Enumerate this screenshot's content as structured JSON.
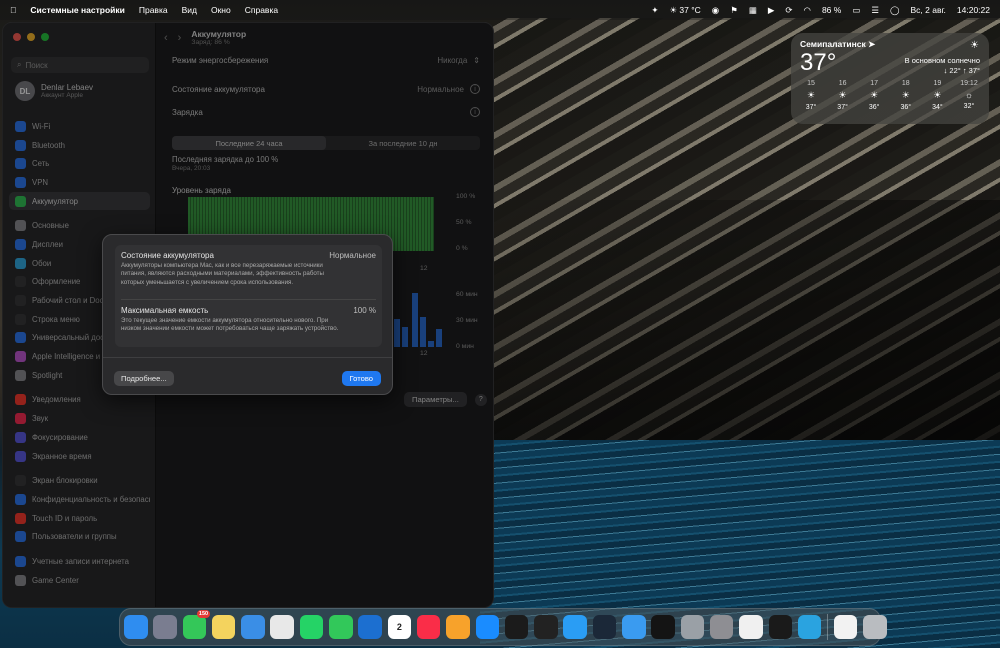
{
  "menubar": {
    "apple": "",
    "app_name": "Системные настройки",
    "menus": [
      "Правка",
      "Вид",
      "Окно",
      "Справка"
    ],
    "weather": "37 °C",
    "battery": "86 %",
    "date": "Вс, 2 авг.",
    "time": "14:20:22"
  },
  "sidebar": {
    "search_placeholder": "Поиск",
    "user_initials": "DL",
    "user_name": "Denlar Lebaev",
    "user_sub": "Аккаунт Apple",
    "items": [
      {
        "label": "Wi-Fi",
        "color": "#2f7bf6"
      },
      {
        "label": "Bluetooth",
        "color": "#2f7bf6"
      },
      {
        "label": "Сеть",
        "color": "#2f7bf6"
      },
      {
        "label": "VPN",
        "color": "#2f7bf6"
      },
      {
        "label": "Аккумулятор",
        "color": "#34c759"
      },
      {
        "label": "Основные",
        "color": "#8e8e93"
      },
      {
        "label": "Дисплеи",
        "color": "#2f7bf6"
      },
      {
        "label": "Обои",
        "color": "#32ade6"
      },
      {
        "label": "Оформление",
        "color": "#3a3a3c"
      },
      {
        "label": "Рабочий стол и Dock",
        "color": "#3a3a3c"
      },
      {
        "label": "Строка меню",
        "color": "#3a3a3c"
      },
      {
        "label": "Универсальный доступ",
        "color": "#2f7bf6"
      },
      {
        "label": "Apple Intelligence и Siri",
        "color": "#c35ad6"
      },
      {
        "label": "Spotlight",
        "color": "#8e8e93"
      },
      {
        "label": "Уведомления",
        "color": "#ff3b30"
      },
      {
        "label": "Звук",
        "color": "#ff2d55"
      },
      {
        "label": "Фокусирование",
        "color": "#5e5ce6"
      },
      {
        "label": "Экранное время",
        "color": "#5e5ce6"
      },
      {
        "label": "Экран блокировки",
        "color": "#3a3a3c"
      },
      {
        "label": "Конфиденциальность и безопасность",
        "color": "#2f7bf6"
      },
      {
        "label": "Touch ID и пароль",
        "color": "#ff3b30"
      },
      {
        "label": "Пользователи и группы",
        "color": "#2f7bf6"
      },
      {
        "label": "Учетные записи интернета",
        "color": "#2f7bf6"
      },
      {
        "label": "Game Center",
        "color": "#8e8e93"
      }
    ]
  },
  "main": {
    "title": "Аккумулятор",
    "subtitle": "Заряд: 86 %",
    "rows": [
      {
        "label": "Режим энергосбережения",
        "value": "Никогда"
      },
      {
        "label": "Состояние аккумулятора",
        "value": "Нормальное"
      },
      {
        "label": "Зарядка",
        "value": ""
      }
    ],
    "tabs": [
      "Последние 24 часа",
      "За последние 10 дн"
    ],
    "last_charge": "Последняя зарядка до 100 %",
    "last_charge_time": "Вчера, 20:03",
    "chart_title": "Уровень заряда",
    "y_labels_level": [
      "100 %",
      "50 %",
      "0 %"
    ],
    "y_labels_usage": [
      "60 мин",
      "30 мин",
      "0 мин"
    ],
    "x_label": "12",
    "params_button": "Параметры...",
    "help": "?"
  },
  "modal": {
    "health_title": "Состояние аккумулятора",
    "health_value": "Нормальное",
    "health_desc": "Аккумуляторы компьютера Mac, как и все перезаряжаемые источники питания, являются расходными материалами, эффективность работы которых уменьшается с увеличением срока использования.",
    "capacity_title": "Максимальная емкость",
    "capacity_value": "100 %",
    "capacity_desc": "Это текущее значение емкости аккумулятора относительно нового. При низком значении емкости может потребоваться чаще заряжать устройство.",
    "more_button": "Подробнее...",
    "done_button": "Готово"
  },
  "weather": {
    "city": "Семипалатинск",
    "temp": "37°",
    "desc": "В основном солнечно",
    "range": "↓ 22° ↑ 37°",
    "hours": [
      {
        "t": "15",
        "v": "37°"
      },
      {
        "t": "16",
        "v": "37°"
      },
      {
        "t": "17",
        "v": "36°"
      },
      {
        "t": "18",
        "v": "36°"
      },
      {
        "t": "19",
        "v": "34°"
      },
      {
        "t": "19:12",
        "v": "32°"
      }
    ]
  },
  "dock": {
    "badge": "150",
    "calendar_day": "2",
    "apps": [
      {
        "name": "finder",
        "color": "#2f8df0"
      },
      {
        "name": "launchpad",
        "color": "#7a7d90"
      },
      {
        "name": "messages",
        "color": "#34c759"
      },
      {
        "name": "notes",
        "color": "#f4d35e"
      },
      {
        "name": "weather",
        "color": "#3a8ee6"
      },
      {
        "name": "photos",
        "color": "#e8e8e8"
      },
      {
        "name": "whatsapp",
        "color": "#25d366"
      },
      {
        "name": "facetime",
        "color": "#32c85a"
      },
      {
        "name": "freeform",
        "color": "#1c6fd0"
      },
      {
        "name": "calendar",
        "color": "#ffffff"
      },
      {
        "name": "music",
        "color": "#fa2d48"
      },
      {
        "name": "pages",
        "color": "#f7a22b"
      },
      {
        "name": "app-store",
        "color": "#1a8cff"
      },
      {
        "name": "terminal-app",
        "color": "#1b1b1b"
      },
      {
        "name": "activity",
        "color": "#222"
      },
      {
        "name": "safari",
        "color": "#2a9df4"
      },
      {
        "name": "steam",
        "color": "#1b2838"
      },
      {
        "name": "mail",
        "color": "#3a9bf0"
      },
      {
        "name": "speedtest",
        "color": "#141414"
      },
      {
        "name": "disk-utility",
        "color": "#9aa0a6"
      },
      {
        "name": "system-settings",
        "color": "#8e8e93"
      },
      {
        "name": "perplexity",
        "color": "#f0f0f0"
      },
      {
        "name": "sunflower",
        "color": "#1a1a1a"
      },
      {
        "name": "telegram",
        "color": "#2aa3e0"
      }
    ]
  }
}
